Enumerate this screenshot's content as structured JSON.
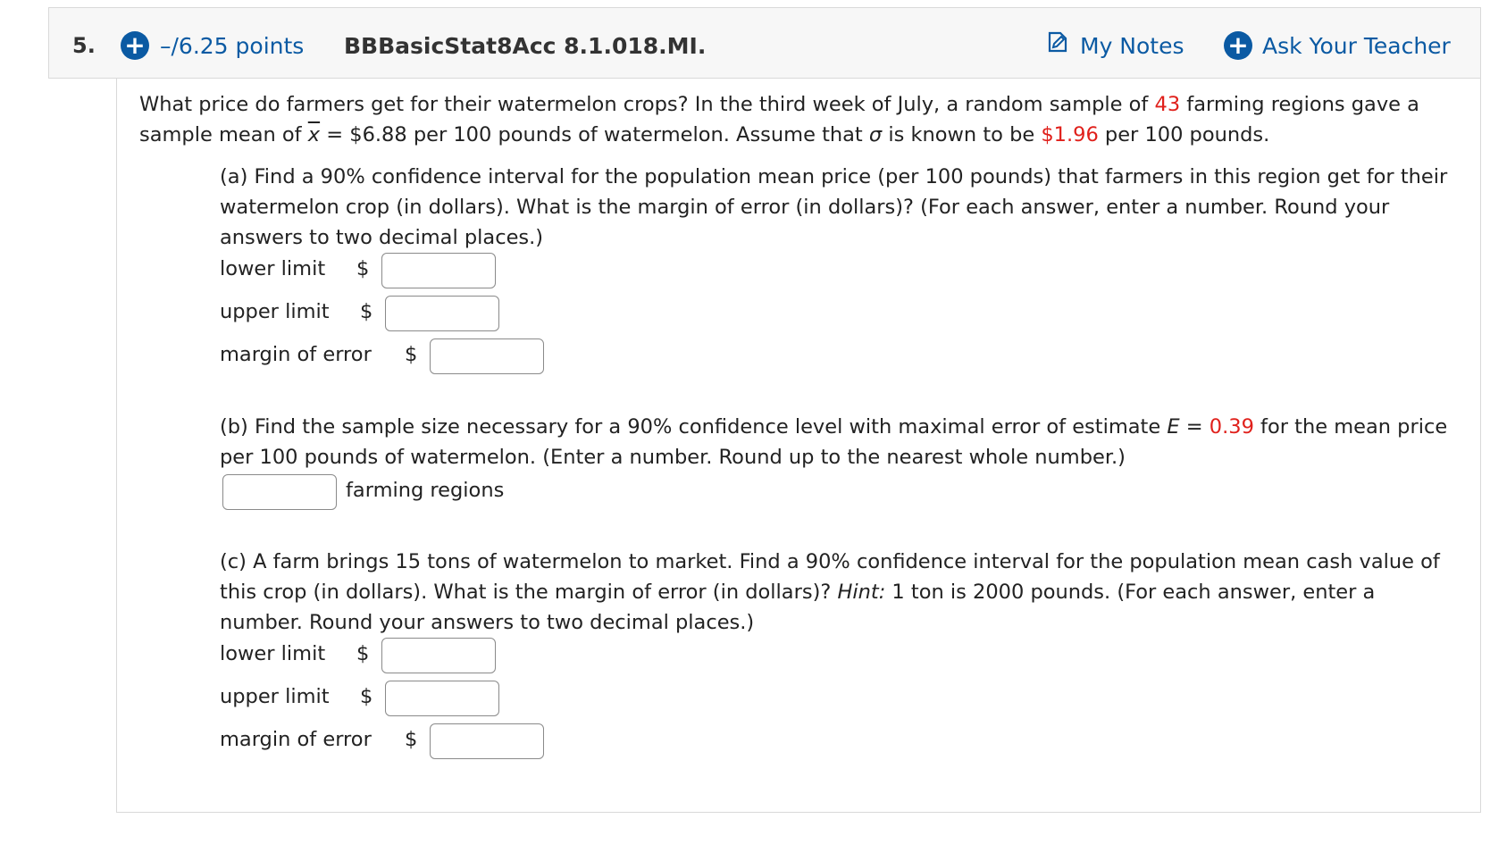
{
  "header": {
    "question_number": "5.",
    "points": "–/6.25 points",
    "question_id": "BBBasicStat8Acc 8.1.018.MI.",
    "my_notes": "My Notes",
    "ask_teacher": "Ask Your Teacher",
    "accent_color": "#0b5aa3"
  },
  "intro": {
    "l1_a": "What price do farmers get for their watermelon crops? In the third week of July, a random sample of ",
    "sample_n": "43",
    "l1_b": " farming regions gave a",
    "l2_a": "sample mean of ",
    "xbar": "x",
    "l2_b": " = $6.88 per 100 pounds of watermelon. Assume that ",
    "sigma": "σ",
    "l2_c": " is known to be ",
    "sigma_value": "$1.96",
    "l2_d": " per 100 pounds.",
    "highlight_color": "#e0201b"
  },
  "part_a": {
    "l1": "(a) Find a 90% confidence interval for the population mean price (per 100 pounds) that farmers in this region get for their",
    "l2": "watermelon crop (in dollars). What is the margin of error (in dollars)? (For each answer, enter a number. Round your",
    "l3": "answers to two decimal places.)",
    "lower_label": "lower limit",
    "upper_label": "upper limit",
    "margin_label": "margin of error",
    "currency": "$"
  },
  "part_b": {
    "l1_a": "(b) Find the sample size necessary for a 90% confidence level with maximal error of estimate ",
    "e_symbol": "E",
    "l1_b": " = ",
    "e_value": "0.39",
    "l1_c": " for the mean price",
    "l2": "per 100 pounds of watermelon. (Enter a number. Round up to the nearest whole number.)",
    "unit_label": "farming regions"
  },
  "part_c": {
    "l1": "(c) A farm brings 15 tons of watermelon to market. Find a 90% confidence interval for the population mean cash value of",
    "l2_a": "this crop (in dollars). What is the margin of error (in dollars)? ",
    "hint": "Hint:",
    "l2_b": " 1 ton is 2000 pounds. (For each answer, enter a",
    "l3": "number. Round your answers to two decimal places.)",
    "lower_label": "lower limit",
    "upper_label": "upper limit",
    "margin_label": "margin of error",
    "currency": "$"
  }
}
